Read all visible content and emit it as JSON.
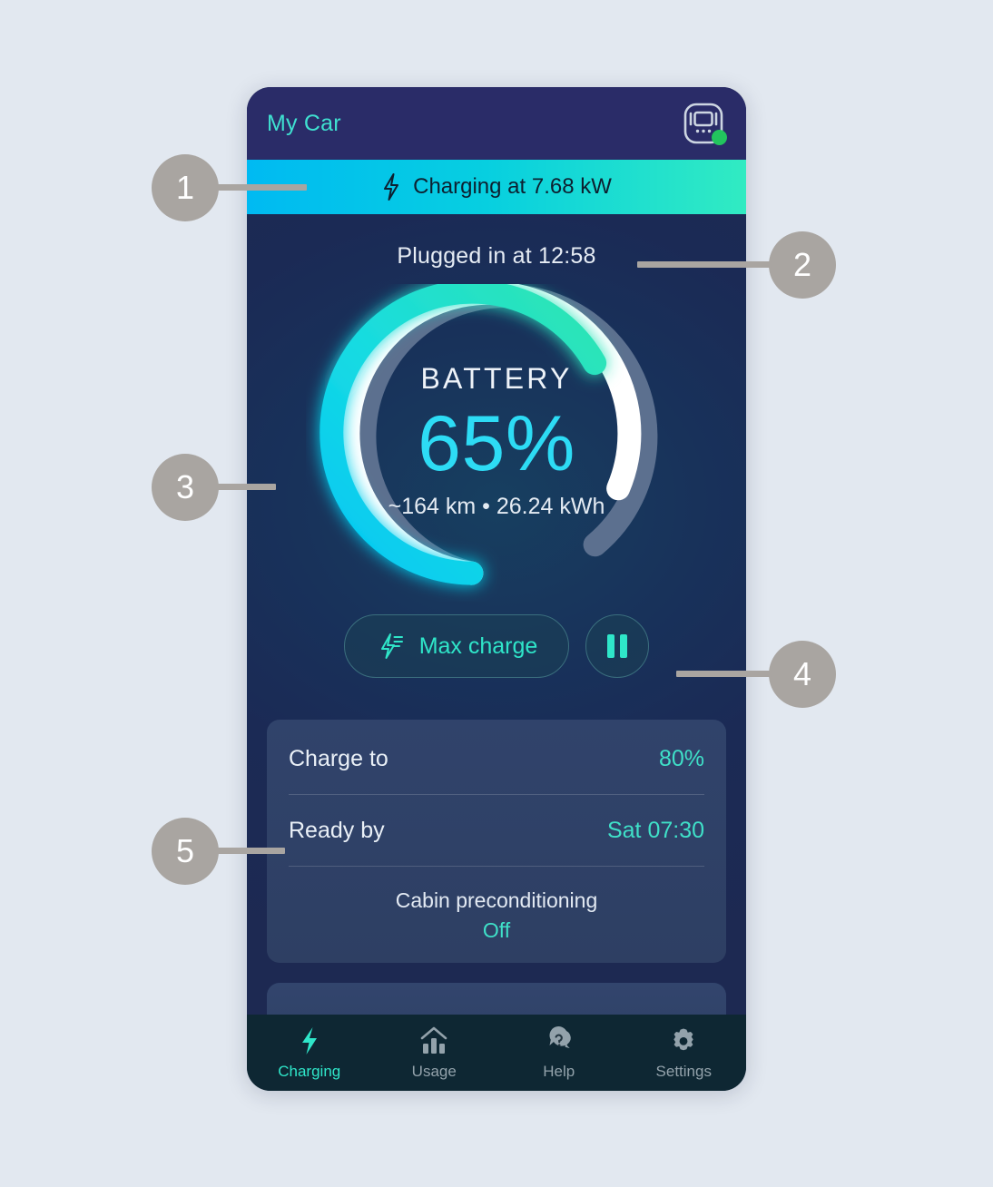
{
  "background_color": "#e2e8f0",
  "header": {
    "title": "My Car",
    "title_color": "#3fe0d0",
    "device_icon": "wallbox-icon",
    "status_dot": "online-status-dot",
    "status_dot_color": "#22c55e"
  },
  "charging_banner": {
    "icon": "lightning-bolt-icon",
    "text": "Charging at 7.68 kW",
    "gradient_from": "#00baf2",
    "gradient_to": "#31ebc2"
  },
  "plugged_in": {
    "text": "Plugged in at 12:58"
  },
  "gauge": {
    "label": "BATTERY",
    "percent_text": "65%",
    "percent_value": 65,
    "target_value": 80,
    "subtext": "~164 km • 26.24 kWh",
    "range_km": "~164 km",
    "energy_kwh": "26.24 kWh",
    "fill_color_start": "#00c6f5",
    "fill_color_end": "#2fe6b0",
    "target_color": "#ffffff",
    "track_color": "#5c708f",
    "percent_color": "#2ddcf5"
  },
  "actions": {
    "max_charge_label": "Max charge",
    "max_charge_icon": "bolt-boost-icon",
    "pause_icon": "pause-icon",
    "accent_color": "#2fe6c9"
  },
  "settings_card": {
    "rows": [
      {
        "label": "Charge to",
        "value": "80%"
      },
      {
        "label": "Ready by",
        "value": "Sat 07:30"
      }
    ],
    "preconditioning": {
      "title": "Cabin preconditioning",
      "state": "Off"
    }
  },
  "tabbar": {
    "tabs": [
      {
        "label": "Charging",
        "icon": "bolt-icon",
        "active": true
      },
      {
        "label": "Usage",
        "icon": "bar-chart-icon",
        "active": false
      },
      {
        "label": "Help",
        "icon": "question-chat-icon",
        "active": false
      },
      {
        "label": "Settings",
        "icon": "gear-icon",
        "active": false
      }
    ],
    "active_color": "#2fe6c9",
    "inactive_color": "#93a2ab"
  },
  "callouts": [
    {
      "number": "1"
    },
    {
      "number": "2"
    },
    {
      "number": "3"
    },
    {
      "number": "4"
    },
    {
      "number": "5"
    }
  ]
}
